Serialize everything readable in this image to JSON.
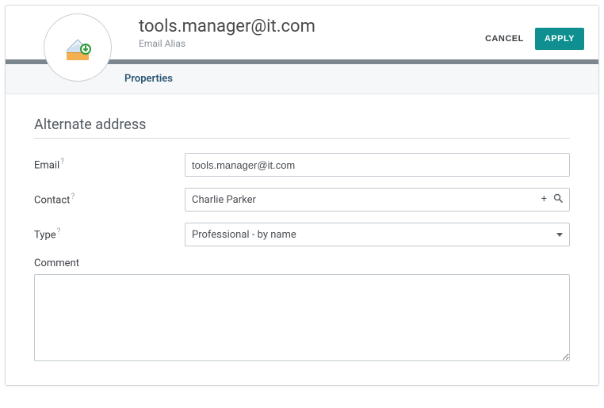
{
  "header": {
    "title": "tools.manager@it.com",
    "subtitle": "Email Alias",
    "cancel_label": "CANCEL",
    "apply_label": "APPLY"
  },
  "tabs": {
    "active": "Properties"
  },
  "section": {
    "title": "Alternate address"
  },
  "fields": {
    "email": {
      "label": "Email",
      "value": "tools.manager@it.com"
    },
    "contact": {
      "label": "Contact",
      "value": "Charlie Parker"
    },
    "type": {
      "label": "Type",
      "value": "Professional - by name"
    },
    "comment": {
      "label": "Comment",
      "value": ""
    }
  }
}
